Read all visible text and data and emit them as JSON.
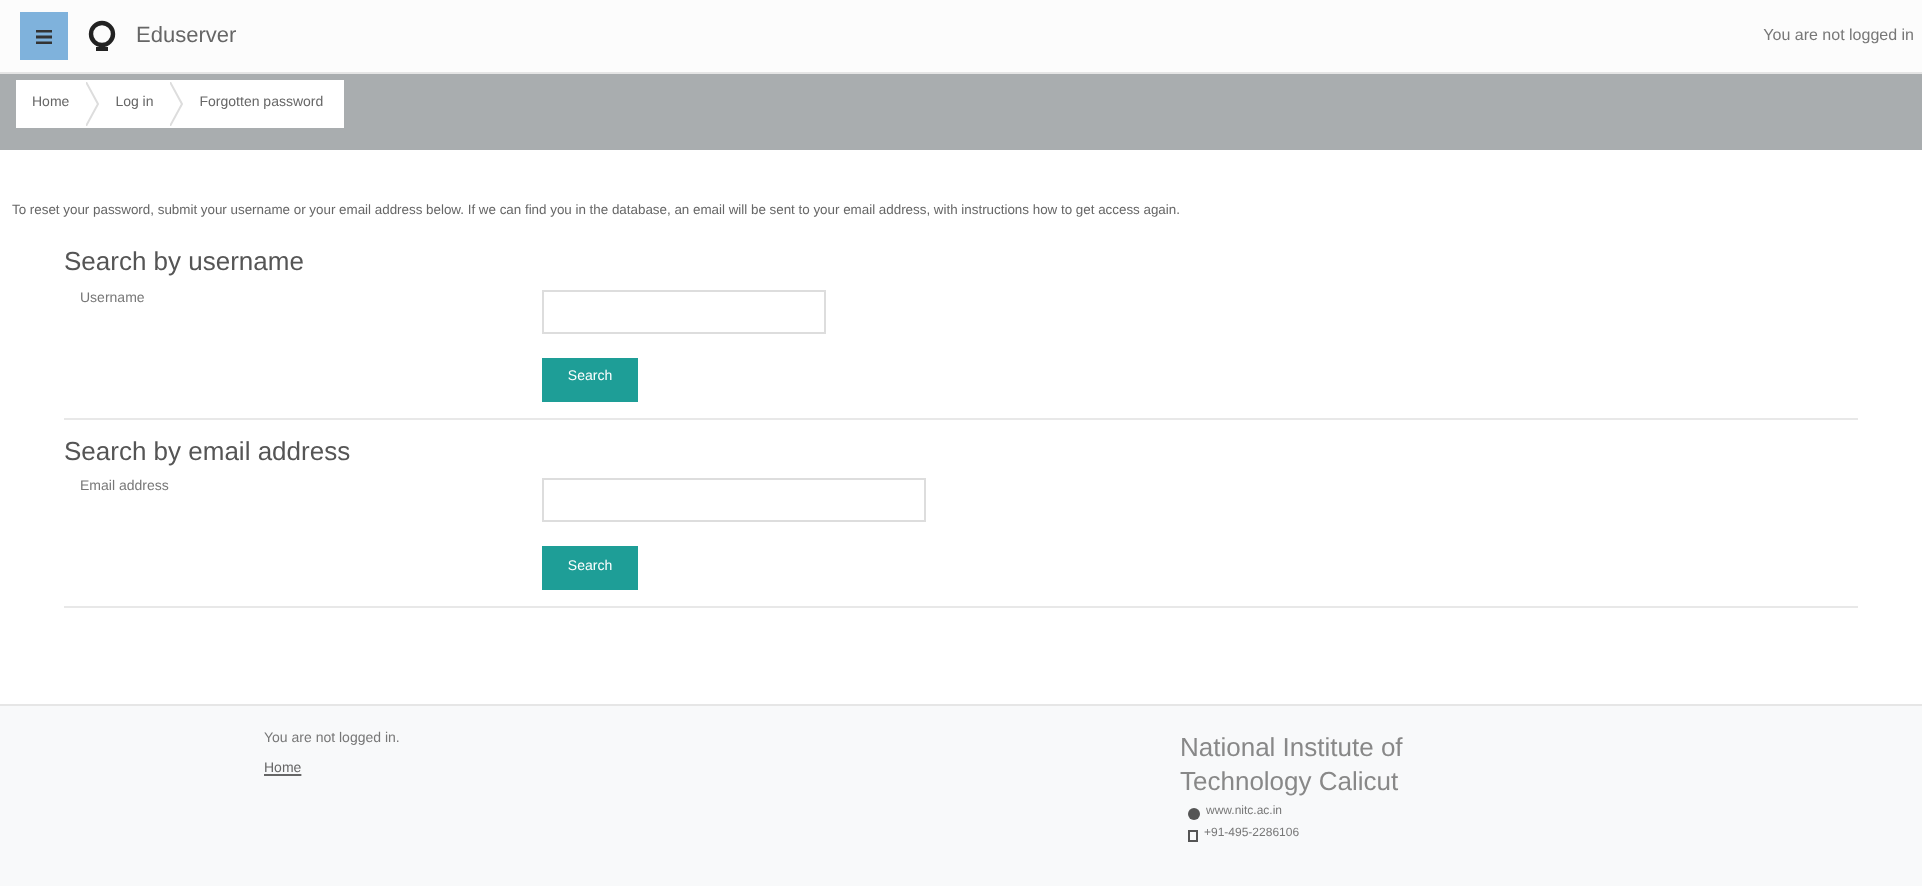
{
  "header": {
    "brand": "Eduserver",
    "login_status": "You are not logged in"
  },
  "breadcrumb": [
    "Home",
    "Log in",
    "Forgotten password"
  ],
  "intro": "To reset your password, submit your username or your email address below. If we can find you in the database, an email will be sent to your email address, with instructions how to get access again.",
  "sections": [
    {
      "title": "Search by username",
      "field_label": "Username",
      "button": "Search",
      "kind": "short"
    },
    {
      "title": "Search by email address",
      "field_label": "Email address",
      "button": "Search",
      "kind": "long"
    }
  ],
  "footer": {
    "status": "You are not logged in.",
    "home_link": "Home",
    "institute": "National Institute of Technology Calicut",
    "website": "www.nitc.ac.in",
    "phone": "+91-495-2286106"
  }
}
